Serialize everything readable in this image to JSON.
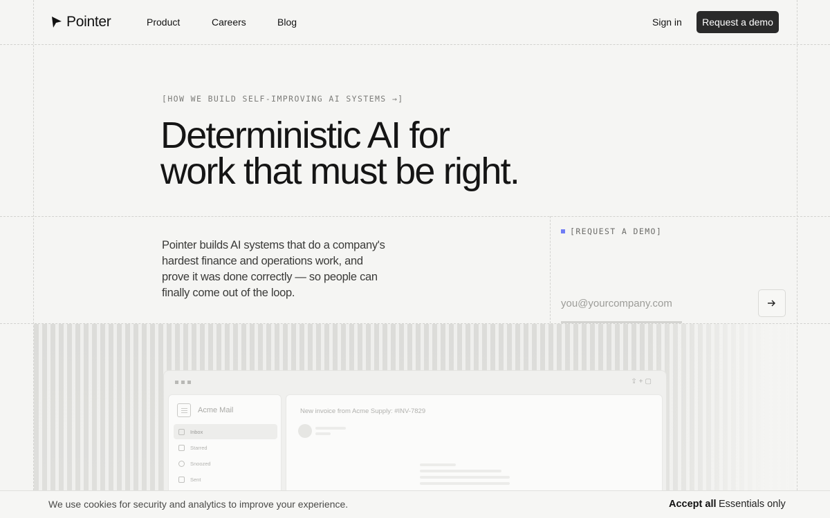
{
  "nav": {
    "brand": "Pointer",
    "links": [
      "Product",
      "Careers",
      "Blog"
    ],
    "sign_in": "Sign in",
    "request_demo": "Request a demo"
  },
  "hero": {
    "eyebrow": "[HOW WE BUILD SELF-IMPROVING AI SYSTEMS →]",
    "headline_line1": "Deterministic AI for",
    "headline_line2": "work that must be right.",
    "description": "Pointer builds AI systems that do a company's hardest finance and operations work, and prove it was done correctly — so people can finally come out of the loop."
  },
  "demo_form": {
    "label": "[REQUEST A DEMO]",
    "email_placeholder": "you@yourcompany.com",
    "submit_icon": "arrow-right-icon",
    "accent": "#6f7cf5"
  },
  "mockup": {
    "app_name": "Acme Mail",
    "folders": [
      "Inbox",
      "Starred",
      "Snoozed",
      "Sent"
    ],
    "subject": "New invoice from Acme Supply: #INV-7829"
  },
  "cookie": {
    "text": "We use cookies for security and analytics to improve your experience.",
    "accept": "Accept all",
    "essentials": "Essentials only"
  }
}
